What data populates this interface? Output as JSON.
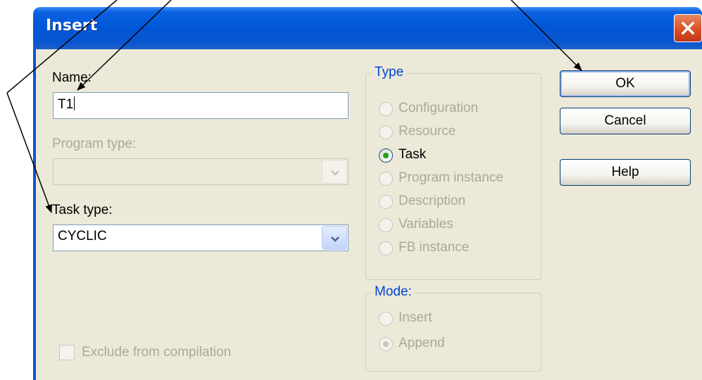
{
  "dialog": {
    "title": "Insert",
    "name_label": "Name:",
    "name_value": "T1",
    "program_type_label": "Program type:",
    "program_type_value": "",
    "task_type_label": "Task type:",
    "task_type_value": "CYCLIC",
    "exclude_label": "Exclude from compilation",
    "type_group": {
      "title": "Type",
      "options": [
        {
          "label": "Configuration",
          "enabled": false,
          "selected": false
        },
        {
          "label": "Resource",
          "enabled": false,
          "selected": false
        },
        {
          "label": "Task",
          "enabled": true,
          "selected": true
        },
        {
          "label": "Program instance",
          "enabled": false,
          "selected": false
        },
        {
          "label": "Description",
          "enabled": false,
          "selected": false
        },
        {
          "label": "Variables",
          "enabled": false,
          "selected": false
        },
        {
          "label": "FB instance",
          "enabled": false,
          "selected": false
        }
      ]
    },
    "mode_group": {
      "title": "Mode:",
      "options": [
        {
          "label": "Insert",
          "enabled": false,
          "selected": false
        },
        {
          "label": "Append",
          "enabled": false,
          "selected": true
        }
      ]
    },
    "buttons": {
      "ok": "OK",
      "cancel": "Cancel",
      "help": "Help"
    }
  },
  "colors": {
    "titlebar": "#0a56d0",
    "face": "#ece9d8",
    "group_title": "#0046d5",
    "disabled_text": "#aca899",
    "radio_dot": "#21a121"
  },
  "icons": {
    "close": "close-icon",
    "dropdown": "chevron-down-icon"
  }
}
